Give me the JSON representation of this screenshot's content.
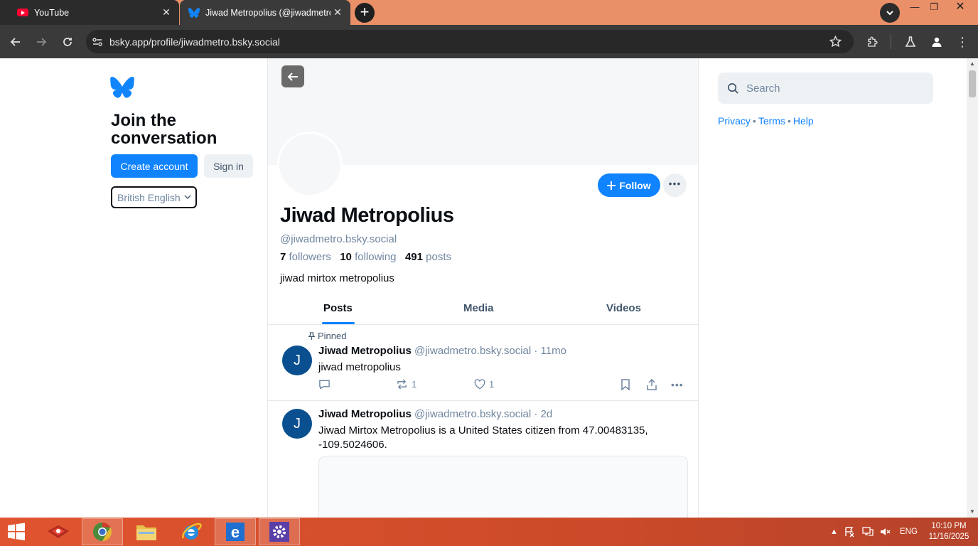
{
  "browser": {
    "tabs": [
      {
        "title": "YouTube",
        "active": false
      },
      {
        "title": "Jiwad Metropolius (@jiwadmetro",
        "active": true
      }
    ],
    "url": "bsky.app/profile/jiwadmetro.bsky.social"
  },
  "left": {
    "heading": "Join the conversation",
    "create_account": "Create account",
    "sign_in": "Sign in",
    "language": "British English"
  },
  "profile": {
    "name": "Jiwad Metropolius",
    "handle": "@jiwadmetro.bsky.social",
    "followers_count": "7",
    "followers_label": "followers",
    "following_count": "10",
    "following_label": "following",
    "posts_count": "491",
    "posts_label": "posts",
    "bio": "jiwad mirtox metropolius",
    "follow_label": "Follow",
    "tabs": [
      "Posts",
      "Media",
      "Videos"
    ]
  },
  "posts": [
    {
      "pinned_label": "Pinned",
      "avatar_letter": "J",
      "author": "Jiwad Metropolius",
      "meta": "@jiwadmetro.bsky.social · 11mo",
      "text": "jiwad metropolius",
      "reposts": "1",
      "likes": "1"
    },
    {
      "avatar_letter": "J",
      "author": "Jiwad Metropolius",
      "meta": "@jiwadmetro.bsky.social · 2d",
      "text": "Jiwad Mirtox Metropolius is a United States citizen from 47.00483135, -109.5024606."
    }
  ],
  "right": {
    "search_placeholder": "Search",
    "links": [
      "Privacy",
      "Terms",
      "Help"
    ]
  },
  "taskbar": {
    "language": "ENG",
    "time": "10:10 PM",
    "date": "11/16/2025"
  },
  "colors": {
    "accent": "#1083fe",
    "tabbar": "#e99068",
    "taskbar": "#cc4a29"
  }
}
